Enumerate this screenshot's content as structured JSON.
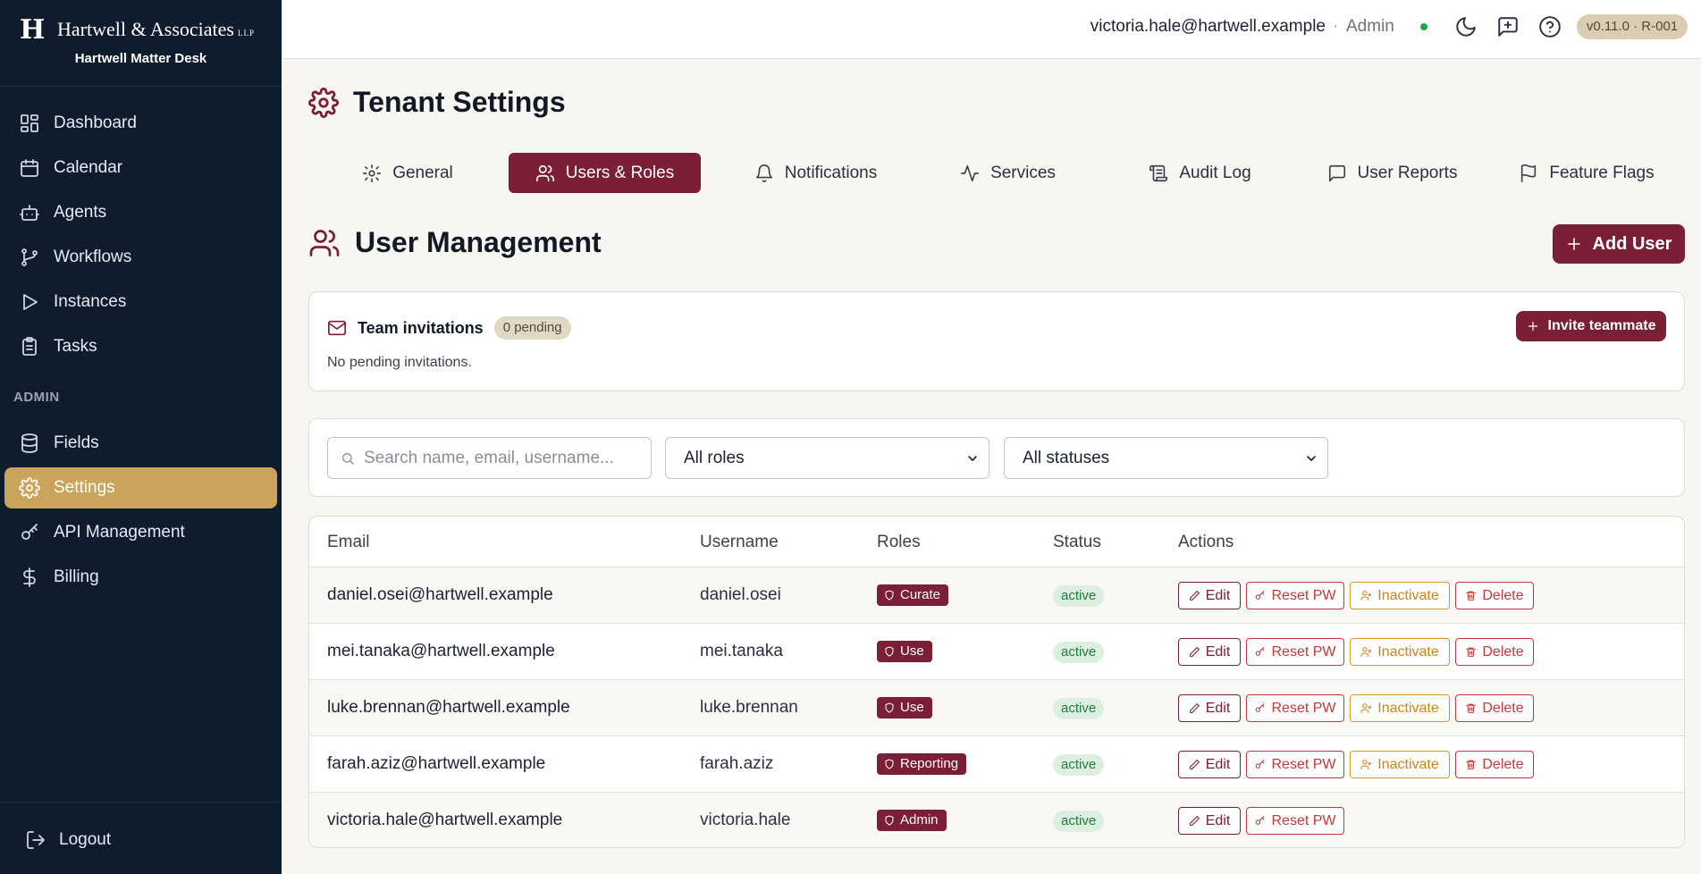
{
  "brand": {
    "logo_letter": "H",
    "name": "Hartwell & Associates",
    "suffix": "LLP",
    "app_name": "Hartwell Matter Desk"
  },
  "sidebar": {
    "items": [
      {
        "label": "Dashboard",
        "icon": "dashboard-icon"
      },
      {
        "label": "Calendar",
        "icon": "calendar-icon"
      },
      {
        "label": "Agents",
        "icon": "bot-icon"
      },
      {
        "label": "Workflows",
        "icon": "git-branch-icon"
      },
      {
        "label": "Instances",
        "icon": "play-icon"
      },
      {
        "label": "Tasks",
        "icon": "clipboard-icon"
      }
    ],
    "admin_section": "ADMIN",
    "admin_items": [
      {
        "label": "Fields",
        "icon": "database-icon"
      },
      {
        "label": "Settings",
        "icon": "gear-icon",
        "active": true
      },
      {
        "label": "API Management",
        "icon": "key-icon"
      },
      {
        "label": "Billing",
        "icon": "dollar-icon"
      }
    ],
    "logout": "Logout"
  },
  "topbar": {
    "user_email": "victoria.hale@hartwell.example",
    "separator": "·",
    "role": "Admin",
    "version": "v0.11.0 · R-001"
  },
  "page": {
    "title": "Tenant Settings",
    "tabs": [
      {
        "label": "General",
        "icon": "gear-icon"
      },
      {
        "label": "Users & Roles",
        "icon": "users-icon",
        "active": true
      },
      {
        "label": "Notifications",
        "icon": "bell-icon"
      },
      {
        "label": "Services",
        "icon": "activity-icon"
      },
      {
        "label": "Audit Log",
        "icon": "scroll-icon"
      },
      {
        "label": "User Reports",
        "icon": "message-icon"
      },
      {
        "label": "Feature Flags",
        "icon": "flag-icon"
      }
    ]
  },
  "user_management": {
    "title": "User Management",
    "add_user": "Add User",
    "invitations": {
      "title": "Team invitations",
      "pending": "0 pending",
      "empty": "No pending invitations.",
      "invite_button": "Invite teammate"
    },
    "filters": {
      "search_placeholder": "Search name, email, username...",
      "role_select": "All roles",
      "status_select": "All statuses"
    },
    "table": {
      "columns": [
        "Email",
        "Username",
        "Roles",
        "Status",
        "Actions"
      ],
      "actions": {
        "edit": "Edit",
        "reset": "Reset PW",
        "inactivate": "Inactivate",
        "delete": "Delete"
      },
      "rows": [
        {
          "email": "daniel.osei@hartwell.example",
          "username": "daniel.osei",
          "role": "Curate",
          "status": "active"
        },
        {
          "email": "mei.tanaka@hartwell.example",
          "username": "mei.tanaka",
          "role": "Use",
          "status": "active"
        },
        {
          "email": "luke.brennan@hartwell.example",
          "username": "luke.brennan",
          "role": "Use",
          "status": "active"
        },
        {
          "email": "farah.aziz@hartwell.example",
          "username": "farah.aziz",
          "role": "Reporting",
          "status": "active"
        },
        {
          "email": "victoria.hale@hartwell.example",
          "username": "victoria.hale",
          "role": "Admin",
          "status": "active"
        }
      ]
    }
  },
  "colors": {
    "accent": "#7a1f36",
    "sidebar_bg": "#0f1c2e",
    "active_nav": "#c9a45a",
    "status_active": "#217a3b"
  }
}
